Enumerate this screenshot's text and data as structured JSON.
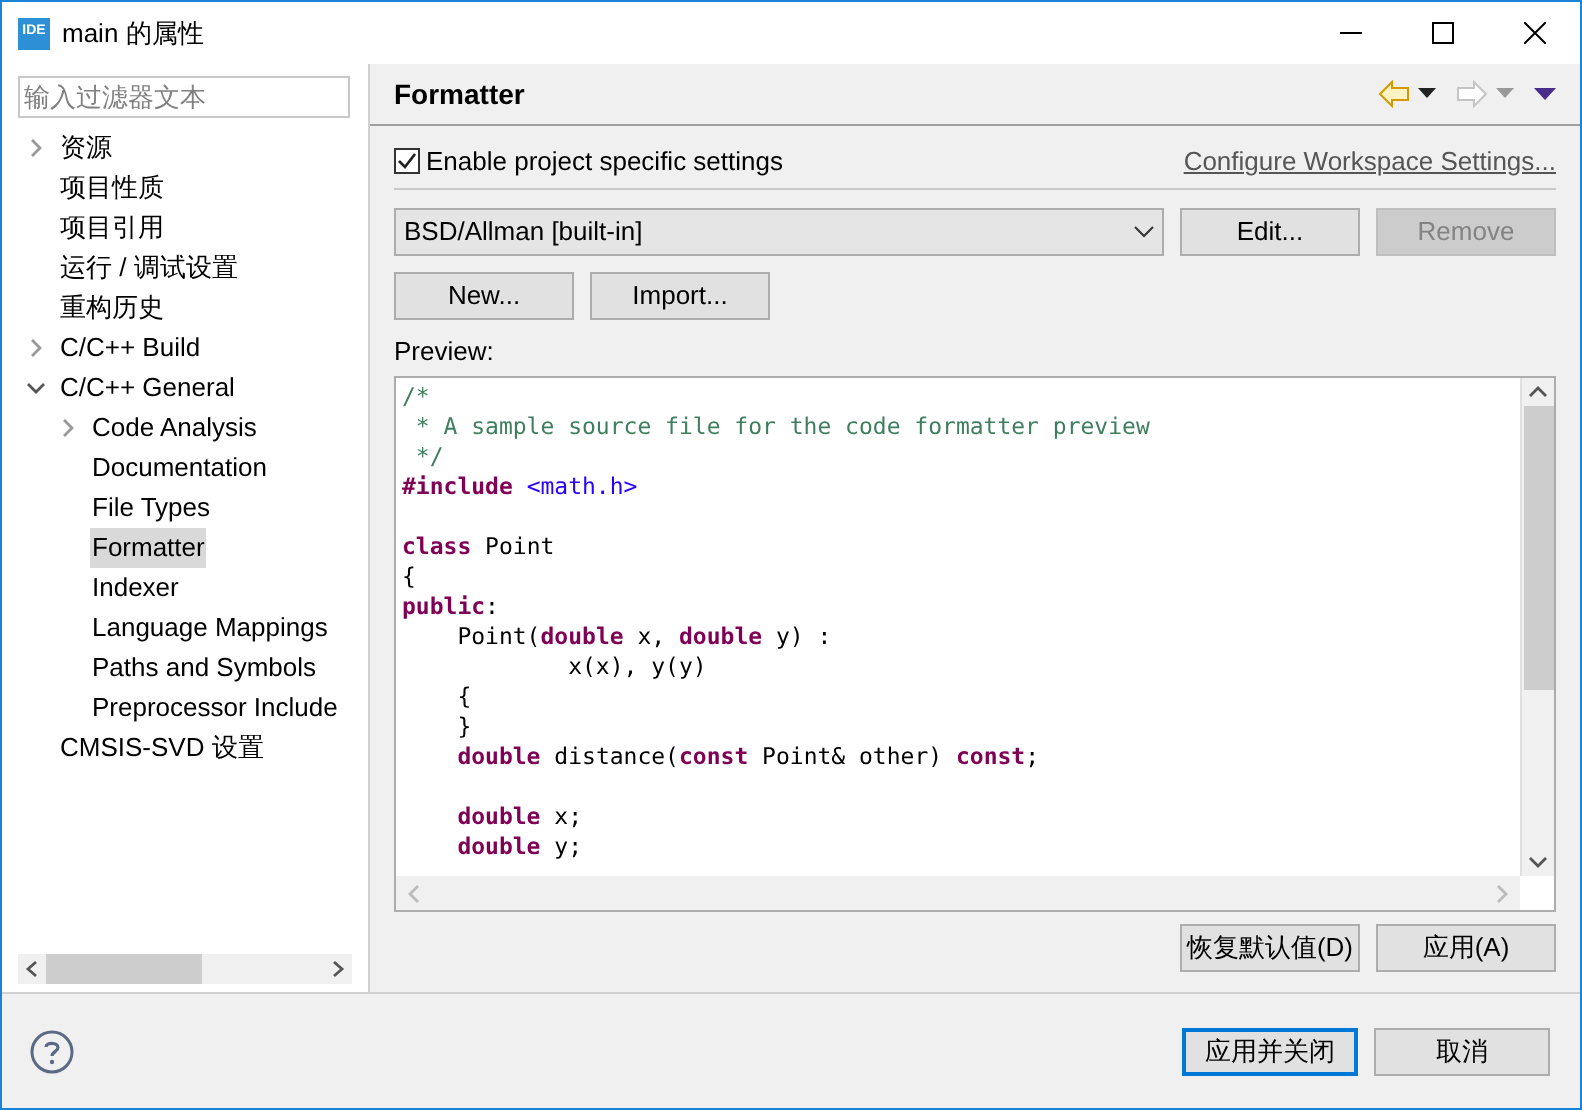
{
  "window": {
    "title": "main 的属性",
    "app_badge": "IDE"
  },
  "filter": {
    "placeholder": "输入过滤器文本"
  },
  "tree": [
    {
      "label": "资源",
      "expanded": false,
      "selected": false
    },
    {
      "label": "项目性质",
      "selected": false
    },
    {
      "label": "项目引用",
      "selected": false
    },
    {
      "label": "运行 / 调试设置",
      "selected": false
    },
    {
      "label": "重构历史",
      "selected": false
    },
    {
      "label": "C/C++ Build",
      "expanded": false,
      "selected": false
    },
    {
      "label": "C/C++ General",
      "expanded": true,
      "selected": false,
      "children": [
        {
          "label": "Code Analysis",
          "expanded": false,
          "selected": false
        },
        {
          "label": "Documentation",
          "selected": false
        },
        {
          "label": "File Types",
          "selected": false
        },
        {
          "label": "Formatter",
          "selected": true
        },
        {
          "label": "Indexer",
          "selected": false
        },
        {
          "label": "Language Mappings",
          "selected": false
        },
        {
          "label": "Paths and Symbols",
          "selected": false
        },
        {
          "label": "Preprocessor Include",
          "selected": false
        }
      ]
    },
    {
      "label": "CMSIS-SVD 设置",
      "selected": false
    }
  ],
  "page": {
    "title": "Formatter",
    "enable_checkbox": {
      "label": "Enable project specific settings",
      "checked": true
    },
    "workspace_link": "Configure Workspace Settings...",
    "profile": {
      "value": "BSD/Allman [built-in]"
    },
    "buttons": [
      {
        "label": "Edit...",
        "disabled": false
      },
      {
        "label": "Remove",
        "disabled": true
      }
    ],
    "buttons2": [
      {
        "label": "New...",
        "disabled": false
      },
      {
        "label": "Import...",
        "disabled": false
      }
    ],
    "preview_label": "Preview:",
    "code": [
      {
        "kind": "code",
        "tokens": [
          {
            "kind": "comment",
            "text": "/*"
          }
        ]
      },
      {
        "kind": "code",
        "tokens": [
          {
            "kind": "comment",
            "text": " * A sample source file for the code formatter preview"
          }
        ]
      },
      {
        "kind": "code",
        "tokens": [
          {
            "kind": "comment",
            "text": " */"
          }
        ]
      },
      {
        "kind": "code",
        "tokens": [
          {
            "kind": "keyword",
            "text": "#include "
          },
          {
            "kind": "string",
            "text": "<math.h>"
          }
        ]
      },
      {
        "kind": "blank"
      },
      {
        "kind": "code",
        "tokens": [
          {
            "kind": "keyword",
            "text": "class"
          },
          {
            "kind": "plain",
            "text": " Point"
          }
        ]
      },
      {
        "kind": "code",
        "tokens": [
          {
            "kind": "plain",
            "text": "{"
          }
        ]
      },
      {
        "kind": "code",
        "tokens": [
          {
            "kind": "keyword",
            "text": "public"
          },
          {
            "kind": "plain",
            "text": ":"
          }
        ]
      },
      {
        "kind": "code",
        "tokens": [
          {
            "kind": "plain",
            "text": "    Point("
          },
          {
            "kind": "keyword",
            "text": "double"
          },
          {
            "kind": "plain",
            "text": " x, "
          },
          {
            "kind": "keyword",
            "text": "double"
          },
          {
            "kind": "plain",
            "text": " y) :"
          }
        ]
      },
      {
        "kind": "code",
        "tokens": [
          {
            "kind": "plain",
            "text": "            x(x), y(y)"
          }
        ]
      },
      {
        "kind": "code",
        "tokens": [
          {
            "kind": "plain",
            "text": "    {"
          }
        ]
      },
      {
        "kind": "code",
        "tokens": [
          {
            "kind": "plain",
            "text": "    }"
          }
        ]
      },
      {
        "kind": "code",
        "tokens": [
          {
            "kind": "keyword",
            "text": "    double"
          },
          {
            "kind": "plain",
            "text": " distance("
          },
          {
            "kind": "keyword",
            "text": "const"
          },
          {
            "kind": "plain",
            "text": " Point& other) "
          },
          {
            "kind": "keyword",
            "text": "const"
          },
          {
            "kind": "plain",
            "text": ";"
          }
        ]
      },
      {
        "kind": "blank"
      },
      {
        "kind": "code",
        "tokens": [
          {
            "kind": "keyword",
            "text": "    double"
          },
          {
            "kind": "plain",
            "text": " x;"
          }
        ]
      },
      {
        "kind": "code",
        "tokens": [
          {
            "kind": "keyword",
            "text": "    double"
          },
          {
            "kind": "plain",
            "text": " y;"
          }
        ]
      }
    ],
    "restore_button": "恢复默认值(D)",
    "apply_button": "应用(A)"
  },
  "footer": {
    "buttons": [
      {
        "label": "应用并关闭",
        "default": true
      },
      {
        "label": "取消",
        "default": false
      }
    ]
  }
}
